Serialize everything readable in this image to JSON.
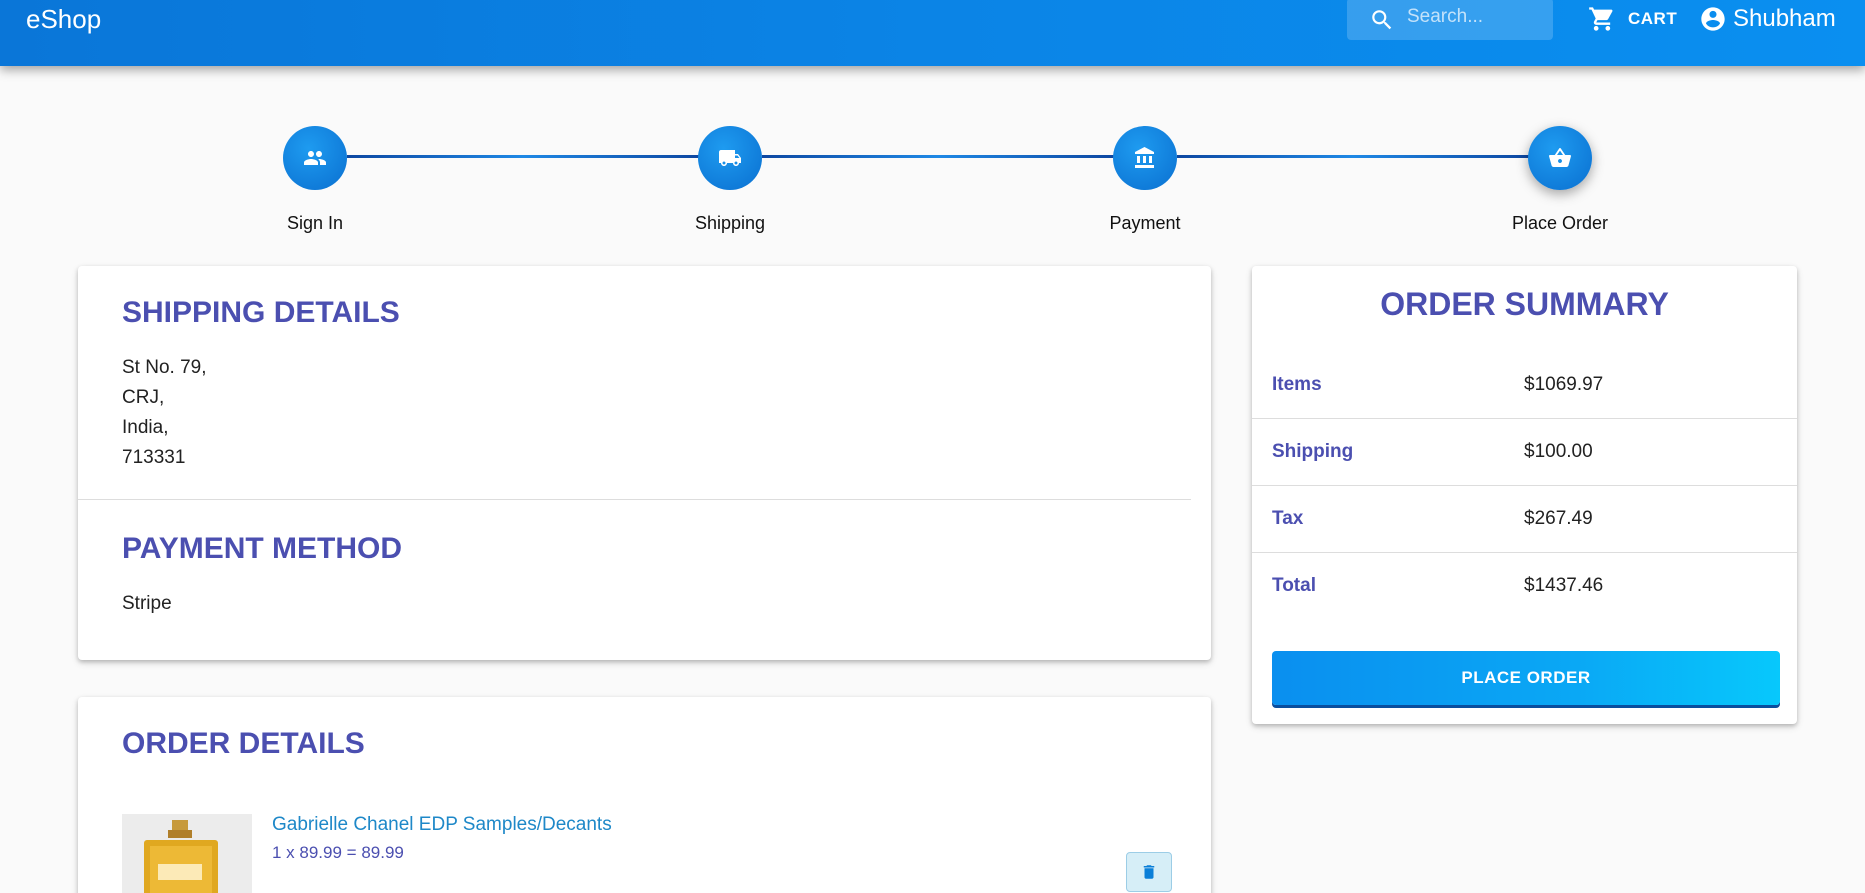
{
  "header": {
    "brand": "eShop",
    "search_placeholder": "Search...",
    "cart_label": "CART",
    "user_name": "Shubham"
  },
  "stepper": {
    "steps": [
      {
        "label": "Sign In",
        "icon": "users-icon"
      },
      {
        "label": "Shipping",
        "icon": "truck-icon"
      },
      {
        "label": "Payment",
        "icon": "bank-icon"
      },
      {
        "label": "Place Order",
        "icon": "basket-icon"
      }
    ],
    "active_step": 3
  },
  "shipping": {
    "title": "SHIPPING DETAILS",
    "address_lines": [
      "St No. 79,",
      "CRJ,",
      "India,",
      "713331"
    ]
  },
  "payment": {
    "title": "PAYMENT METHOD",
    "method": "Stripe"
  },
  "summary": {
    "title": "ORDER SUMMARY",
    "rows": [
      {
        "label": "Items",
        "value": "$1069.97"
      },
      {
        "label": "Shipping",
        "value": "$100.00"
      },
      {
        "label": "Tax",
        "value": "$267.49"
      },
      {
        "label": "Total",
        "value": "$1437.46"
      }
    ],
    "button_label": "PLACE ORDER"
  },
  "order": {
    "title": "ORDER DETAILS",
    "items": [
      {
        "name": "Gabrielle Chanel EDP Samples/Decants",
        "price_line": "1 x 89.99 = 89.99"
      }
    ]
  },
  "colors": {
    "appbar": "#0b84e6",
    "accent_text": "#4b4fb0",
    "link": "#1e88c8",
    "button": "#0aa8f5"
  }
}
